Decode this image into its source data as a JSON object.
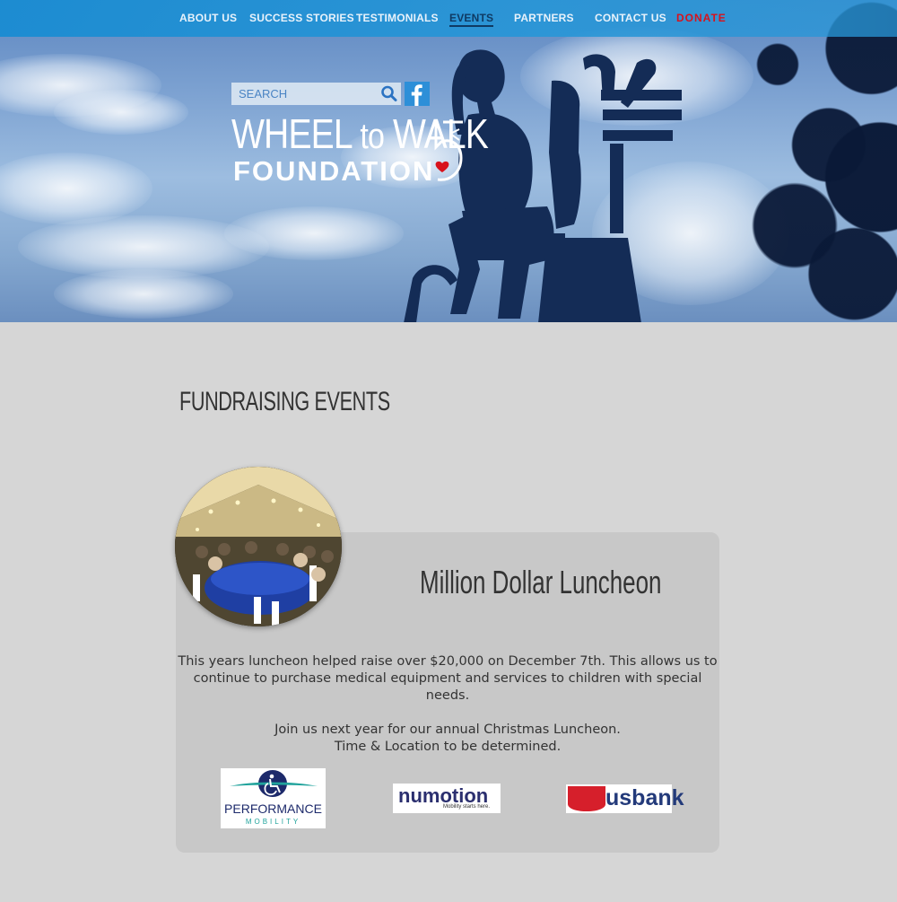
{
  "nav": {
    "items": [
      {
        "label": "ABOUT US"
      },
      {
        "label": "SUCCESS STORIES"
      },
      {
        "label": "TESTIMONIALS"
      },
      {
        "label": "EVENTS"
      },
      {
        "label": "PARTNERS"
      },
      {
        "label": "CONTACT US"
      },
      {
        "label": "DONATE"
      }
    ],
    "active": "EVENTS",
    "donate_color": "#d8121c"
  },
  "search": {
    "placeholder": "SEARCH"
  },
  "logo": {
    "line1_a": "WHEEL",
    "line1_b": "to",
    "line1_c": "WALK",
    "line2": "FOUNDATION"
  },
  "page": {
    "section_title": "FUNDRAISING EVENTS"
  },
  "event": {
    "title": "Million Dollar Luncheon",
    "text1": "This years luncheon helped raise over $20,000 on December 7th. This allows us to continue to purchase medical equipment and services to children with special needs.",
    "text2_line1": "Join us next year for our annual Christmas Luncheon.",
    "text2_line2": "Time & Location to be determined."
  },
  "sponsors": [
    {
      "name": "PERFORMANCE",
      "tagline": "MOBILITY"
    },
    {
      "name": "numotion",
      "tagline": "Mobility starts here."
    },
    {
      "name": "usbank"
    }
  ],
  "colors": {
    "nav_bg": "#1e8cd2",
    "page_bg": "#d6d6d6",
    "card_bg": "#c8c8c8",
    "facebook": "#2d8fd8"
  }
}
